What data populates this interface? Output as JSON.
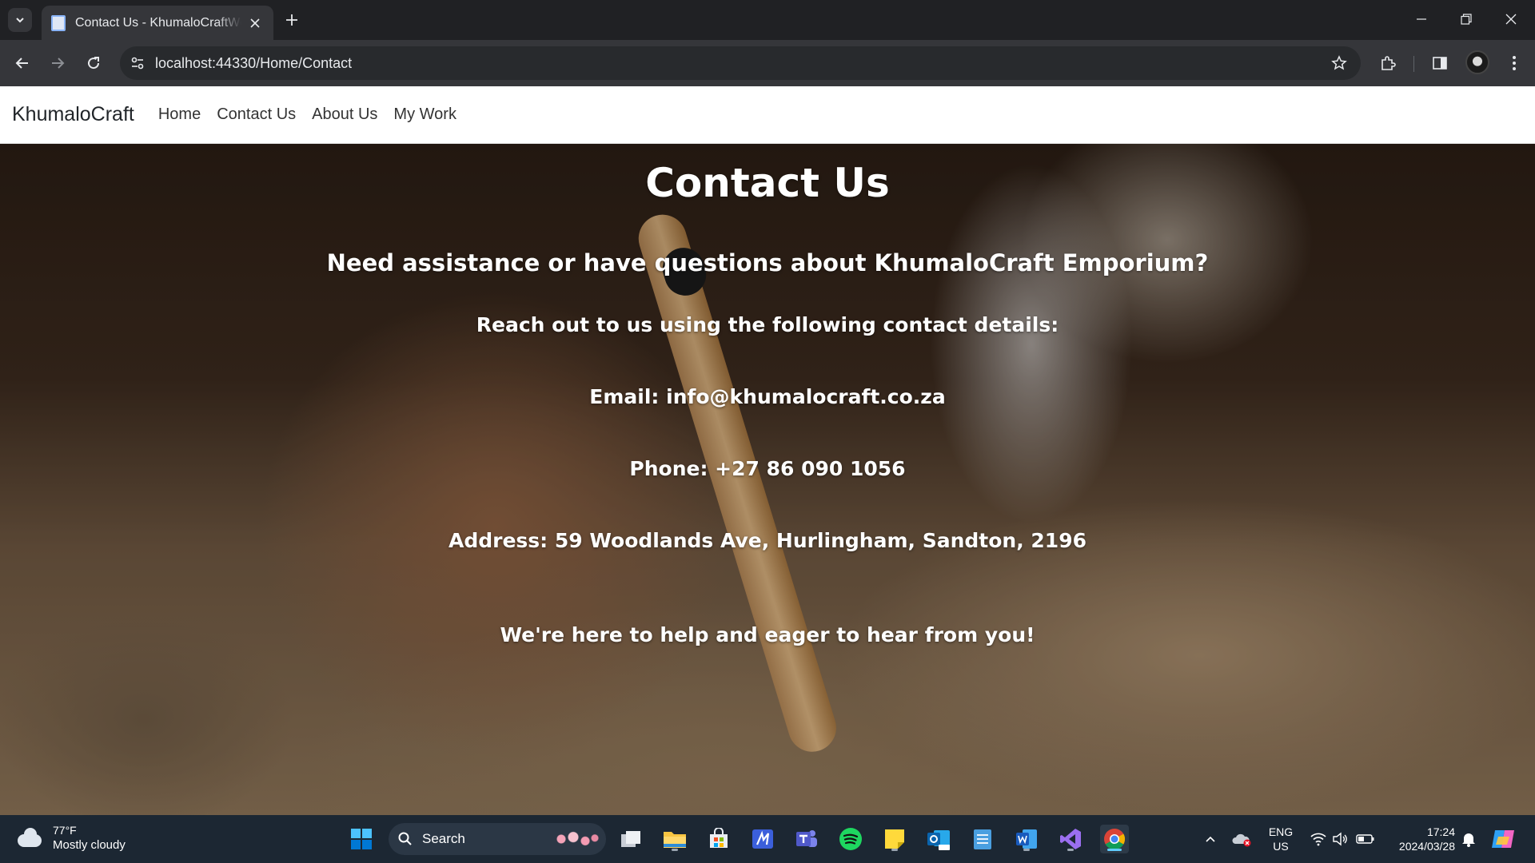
{
  "browser": {
    "tab_title": "Contact Us - KhumaloCraftWeb",
    "url": "localhost:44330/Home/Contact"
  },
  "site": {
    "brand": "KhumaloCraft",
    "nav": [
      "Home",
      "Contact Us",
      "About Us",
      "My Work"
    ]
  },
  "contact": {
    "heading": "Contact Us",
    "intro": "Need assistance or have questions about KhumaloCraft Emporium?",
    "lead": "Reach out to us using the following contact details:",
    "email": "Email: info@khumalocraft.co.za",
    "phone": "Phone: +27 86 090 1056",
    "address": "Address: 59 Woodlands Ave, Hurlingham, Sandton, 2196",
    "closing": "We're here to help and eager to hear from you!"
  },
  "taskbar": {
    "weather_temp": "77°F",
    "weather_condition": "Mostly cloudy",
    "search_label": "Search",
    "language_line1": "ENG",
    "language_line2": "US",
    "time": "17:24",
    "date": "2024/03/28",
    "apps": [
      "start-icon",
      "task-view-icon",
      "file-explorer-icon",
      "microsoft-store-icon",
      "visual-studio-icon",
      "teams-icon",
      "spotify-icon",
      "sticky-notes-icon",
      "outlook-icon",
      "notepad-icon",
      "word-icon",
      "visual-studio-purple-icon",
      "chrome-icon"
    ]
  },
  "colors": {
    "browser_frame": "#202124",
    "toolbar": "#35363a",
    "taskbar": "#1c2733",
    "accent": "#60cdff"
  }
}
